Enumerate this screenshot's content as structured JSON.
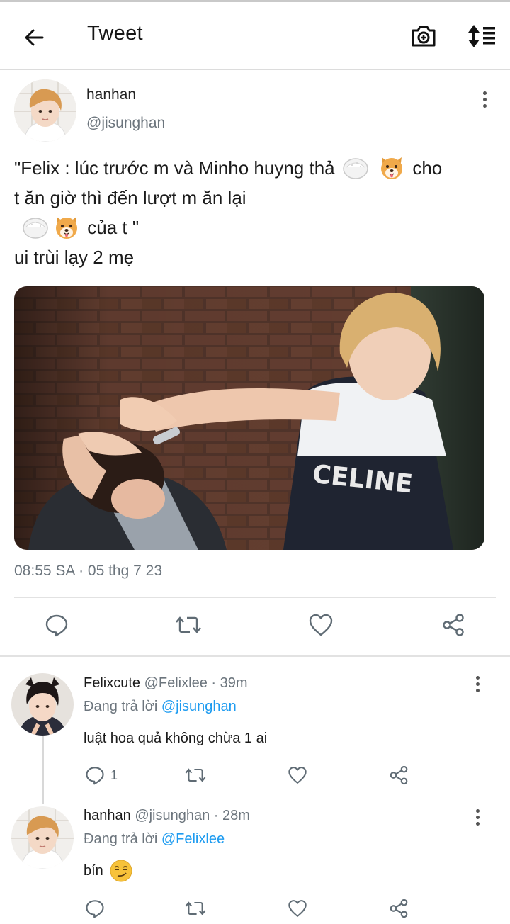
{
  "header": {
    "title": "Tweet"
  },
  "tweet": {
    "author_name": "hanhan",
    "author_handle": "@jisunghan",
    "text_line1_a": "\"Felix : lúc trước m và Minho huyng thả",
    "text_line1_b": "cho",
    "text_line2": "t ăn giờ thì đến lượt m ăn lại",
    "text_line3_b": "của t \"",
    "text_line4": "ui trùi lạy 2 mẹ",
    "timestamp": "08:55 SA · 05 thg 7 23"
  },
  "replies": [
    {
      "name": "Felixcute",
      "handle_meta": "@Felixlee · 39m",
      "replying_prefix": "Đang trả lời",
      "replying_to": "@jisunghan",
      "body": "luật hoa quả không chừa 1 ai",
      "reply_count": "1"
    },
    {
      "name": "hanhan",
      "handle_meta": "@jisunghan · 28m",
      "replying_prefix": "Đang trả lời",
      "replying_to": "@Felixlee",
      "body": "bín"
    }
  ],
  "icons": {
    "back": "arrow-left-icon",
    "camera": "camera-add-icon",
    "sort": "sort-icon",
    "more": "more-vertical-icon",
    "reply": "reply-icon",
    "retweet": "retweet-icon",
    "like": "heart-icon",
    "share": "share-icon",
    "rice": "rice-ball-emoji",
    "dog": "dog-face-emoji",
    "smirk": "smirk-emoji"
  },
  "colors": {
    "mention": "#1d9bf0",
    "secondary_text": "#6c757d"
  }
}
